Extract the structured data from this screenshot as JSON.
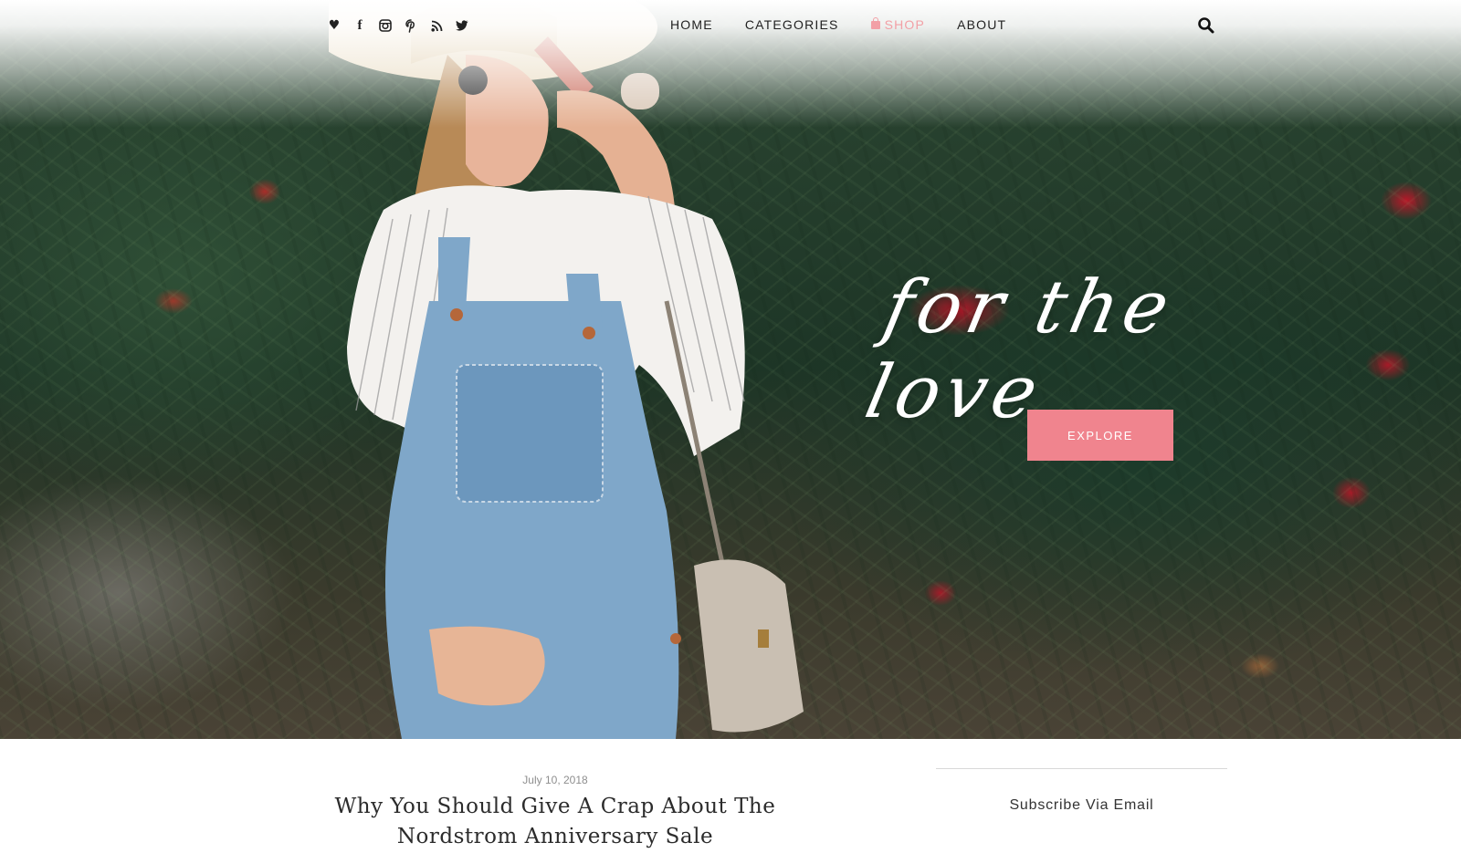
{
  "nav": {
    "social_icons": [
      {
        "name": "heart-icon",
        "glyph": "♥"
      },
      {
        "name": "facebook-icon",
        "glyph": "f"
      },
      {
        "name": "instagram-icon",
        "glyph": "◙"
      },
      {
        "name": "pinterest-icon",
        "glyph": "p"
      },
      {
        "name": "rss-icon",
        "glyph": "◉"
      },
      {
        "name": "twitter-icon",
        "glyph": "✦"
      }
    ],
    "menu": {
      "home": "HOME",
      "categories": "CATEGORIES",
      "shop": "SHOP",
      "about": "ABOUT"
    },
    "search_icon": "search-icon"
  },
  "hero": {
    "script_title": "for the love",
    "explore_label": "EXPLORE"
  },
  "post": {
    "date": "July 10, 2018",
    "title": "Why You Should Give A Crap About The Nordstrom Anniversary Sale"
  },
  "sidebar": {
    "heading": "Subscribe Via Email"
  },
  "colors": {
    "accent_pink": "#f0848e",
    "shop_pink": "#f2a0a6",
    "nav_text": "#222222",
    "date_gray": "#8e8e8e"
  }
}
